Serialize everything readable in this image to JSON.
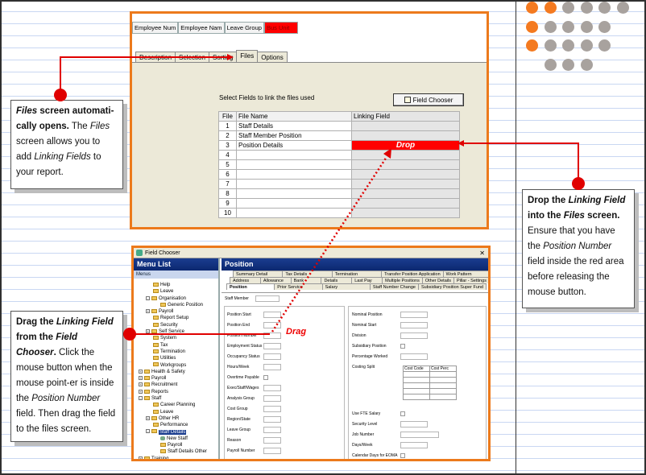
{
  "files_screen": {
    "columns": [
      "Employee Num",
      "Employee Nam",
      "Leave Group",
      "Bus Unit"
    ],
    "tabs": [
      "Description",
      "Selection",
      "Sorting",
      "Files",
      "Options"
    ],
    "active_tab": "Files",
    "select_label": "Select Fields to link the files used",
    "field_chooser_button": "Field Chooser",
    "table": {
      "headers": [
        "File",
        "File Name",
        "Linking Field"
      ],
      "rows": [
        {
          "num": "1",
          "name": "Staff Details",
          "link": ""
        },
        {
          "num": "2",
          "name": "Staff Member Position",
          "link": ""
        },
        {
          "num": "3",
          "name": "Position Details",
          "link": "Drop"
        },
        {
          "num": "4",
          "name": "",
          "link": ""
        },
        {
          "num": "5",
          "name": "",
          "link": ""
        },
        {
          "num": "6",
          "name": "",
          "link": ""
        },
        {
          "num": "7",
          "name": "",
          "link": ""
        },
        {
          "num": "8",
          "name": "",
          "link": ""
        },
        {
          "num": "9",
          "name": "",
          "link": ""
        },
        {
          "num": "10",
          "name": "",
          "link": ""
        }
      ]
    }
  },
  "field_chooser": {
    "window_title": "Field Chooser",
    "menu_list_title": "Menu List",
    "menus_label": "Menus",
    "tree": [
      {
        "label": "Help",
        "level": 1,
        "expander": ""
      },
      {
        "label": "Leave",
        "level": 1,
        "expander": ""
      },
      {
        "label": "Organisation",
        "level": 1,
        "expander": "-"
      },
      {
        "label": "Generic Position",
        "level": 2,
        "expander": ""
      },
      {
        "label": "Payroll",
        "level": 1,
        "expander": "+"
      },
      {
        "label": "Report Setup",
        "level": 1,
        "expander": ""
      },
      {
        "label": "Security",
        "level": 1,
        "expander": ""
      },
      {
        "label": "Self Service",
        "level": 1,
        "expander": "+"
      },
      {
        "label": "System",
        "level": 1,
        "expander": ""
      },
      {
        "label": "Tax",
        "level": 1,
        "expander": ""
      },
      {
        "label": "Termination",
        "level": 1,
        "expander": ""
      },
      {
        "label": "Utilities",
        "level": 1,
        "expander": ""
      },
      {
        "label": "Workgroups",
        "level": 1,
        "expander": ""
      },
      {
        "label": "Health & Safety",
        "level": 0,
        "expander": "+"
      },
      {
        "label": "Payroll",
        "level": 0,
        "expander": "+"
      },
      {
        "label": "Recruitment",
        "level": 0,
        "expander": "+"
      },
      {
        "label": "Reports",
        "level": 0,
        "expander": "+"
      },
      {
        "label": "Staff",
        "level": 0,
        "expander": "-"
      },
      {
        "label": "Career Planning",
        "level": 1,
        "expander": ""
      },
      {
        "label": "Leave",
        "level": 1,
        "expander": ""
      },
      {
        "label": "Other HR",
        "level": 1,
        "expander": "+"
      },
      {
        "label": "Performance",
        "level": 1,
        "expander": ""
      },
      {
        "label": "Staff Details",
        "level": 1,
        "expander": "-",
        "selected": true
      },
      {
        "label": "New Staff",
        "level": 2,
        "expander": "",
        "icon": "staff"
      },
      {
        "label": "Payroll",
        "level": 2,
        "expander": ""
      },
      {
        "label": "Staff Details Other",
        "level": 2,
        "expander": ""
      },
      {
        "label": "Training",
        "level": 0,
        "expander": "+"
      }
    ],
    "position_title": "Position",
    "tab_rows": [
      [
        "Summary Detail",
        "Tax Details",
        "Termination",
        "Transfer Position Application",
        "Work Pattern"
      ],
      [
        "Address",
        "Allowance",
        "Bank",
        "Details",
        "Last Pay",
        "Multiple Positions",
        "Other Details",
        "Pillar - Settings"
      ],
      [
        "Position",
        "Prior Service",
        "Salary",
        "Staff Number Change",
        "Subsidiary Position Super Fund"
      ]
    ],
    "active_tab": "Position",
    "staff_member_label": "Staff Member",
    "left_fields": [
      "Position Start",
      "Position End",
      "Position Number",
      "Employment Status",
      "Occupancy Status",
      "Hours/Week",
      "Overtime Payable",
      "Exec/Staff/Wages",
      "Analysis Group",
      "Cost Group",
      "Region/State",
      "Leave Group",
      "Reason",
      "Payroll Number"
    ],
    "right_fields": [
      "Nominal Position",
      "Nominal Start",
      "Division",
      "Subsidiary Position",
      "Percentage Worked",
      "Costing Split",
      "Use FTE Salary",
      "Security Level",
      "Job Number",
      "Days/Week",
      "Calendar Days for EOMA"
    ],
    "cost_headers": [
      "Cost Code",
      "Cost Perc"
    ]
  },
  "callouts": {
    "files": {
      "p1": "Files",
      "p2": " screen automati-cally opens.",
      "p3": " The ",
      "p4": "Files",
      "p5": " screen allows you to add ",
      "p6": "Linking Fields",
      "p7": " to your report."
    },
    "drop": {
      "p1": "Drop the ",
      "p2": "Linking Field",
      "p3": " into the ",
      "p4": "Files",
      "p5": " screen.",
      "p6": " Ensure that you have the ",
      "p7": "Position Number",
      "p8": " field inside the red area before releasing the mouse button."
    },
    "drag": {
      "p1": "Drag the ",
      "p2": "Linking Field",
      "p3": " from the ",
      "p4": "Field Chooser",
      "p5": ".",
      "p6": " Click the mouse button when the mouse point-er is inside the ",
      "p7": "Position Number",
      "p8": " field. Then drag the field to the files screen."
    }
  },
  "drag_label": "Drag",
  "colors": {
    "accent_orange": "#ec7a1c",
    "arrow_red": "#e00000",
    "dot_orange": "#f47a20",
    "dot_grey": "#a8a29e",
    "header_blue": "#1a3d8f"
  }
}
